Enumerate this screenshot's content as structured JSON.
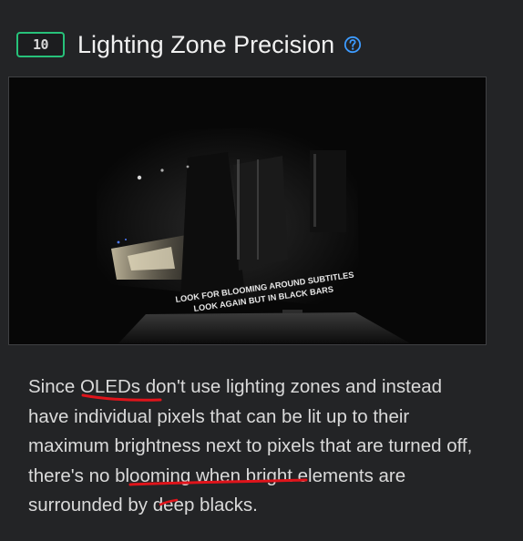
{
  "header": {
    "score": "10",
    "title": "Lighting Zone Precision",
    "help_icon": "question-circle-icon"
  },
  "photo": {
    "caption_line1": "LOOK FOR BLOOMING AROUND SUBTITLES",
    "caption_line2": "LOOK AGAIN BUT IN BLACK BARS"
  },
  "description": {
    "text": "Since OLEDs don't use lighting zones and instead have individual pixels that can be lit up to their maximum brightness next to pixels that are turned off, there's no blooming when bright elements are surrounded by deep blacks."
  },
  "colors": {
    "background": "#232426",
    "badge_border": "#27c27a",
    "help_icon": "#3d9bff",
    "annotation": "#e0141b"
  }
}
